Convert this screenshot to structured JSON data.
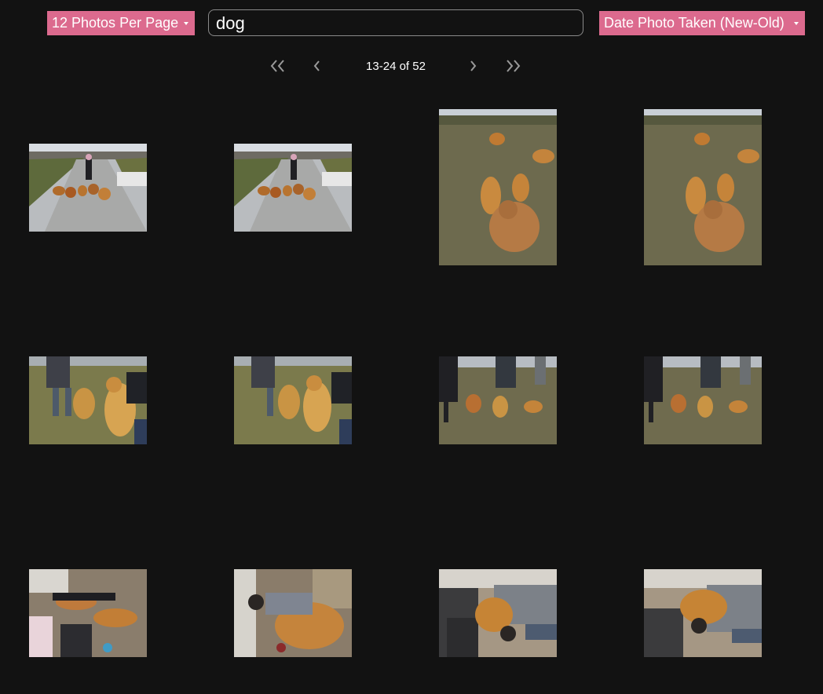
{
  "toolbar": {
    "per_page_label": "12 Photos Per Page",
    "search_value": "dog",
    "search_placeholder": "",
    "sort_label": "Date Photo Taken (New-Old)"
  },
  "pager": {
    "range_text": "13-24 of 52",
    "first_icon": "chevron-double-left-icon",
    "prev_icon": "chevron-left-icon",
    "next_icon": "chevron-right-icon",
    "last_icon": "chevron-double-right-icon"
  },
  "colors": {
    "accent": "#dc6a8e",
    "background": "#121212"
  },
  "photos": [
    {
      "scene": "woman with dogs on path"
    },
    {
      "scene": "woman with dogs on path"
    },
    {
      "scene": "dogs playing in field"
    },
    {
      "scene": "dogs playing in field"
    },
    {
      "scene": "two dogs with people"
    },
    {
      "scene": "two dogs with people"
    },
    {
      "scene": "people with dogs in park"
    },
    {
      "scene": "people with dogs in park"
    },
    {
      "scene": "person with dog indoors"
    },
    {
      "scene": "man hugging dog on floor"
    },
    {
      "scene": "man hugging dog on floor"
    },
    {
      "scene": "man hugging dog on floor"
    }
  ]
}
